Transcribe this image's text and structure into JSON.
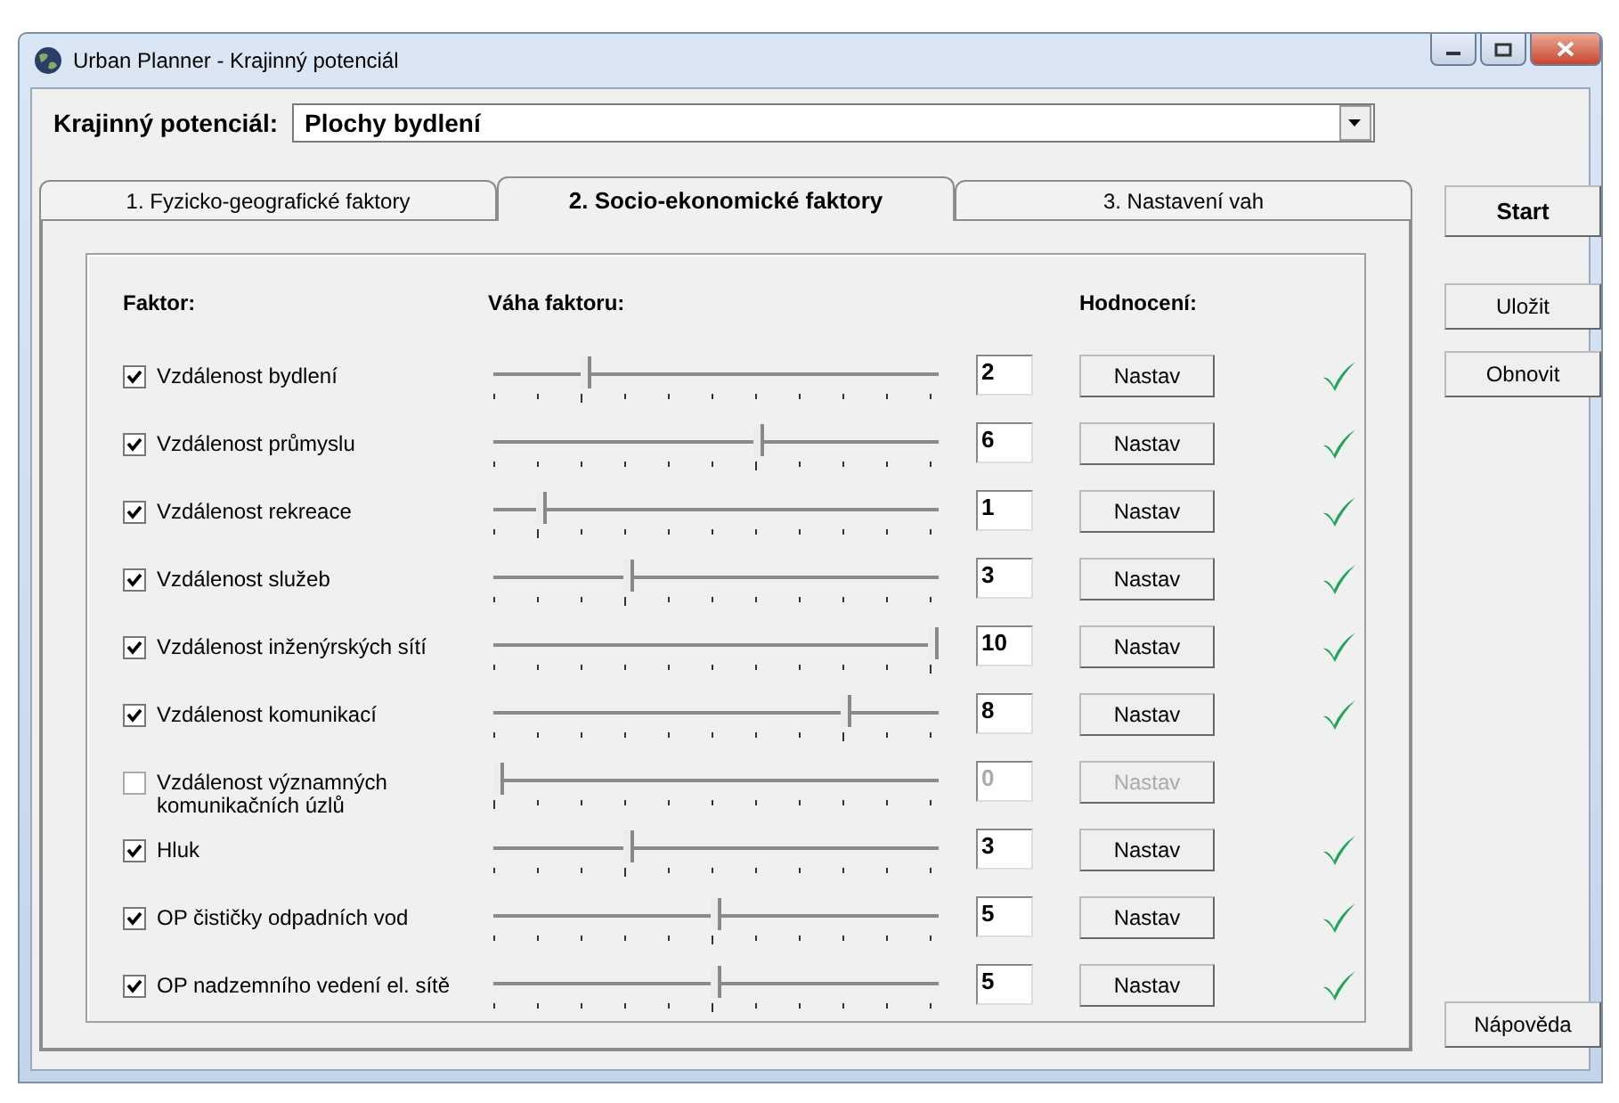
{
  "window": {
    "title": "Urban Planner - Krajinný potenciál"
  },
  "potential": {
    "label": "Krajinný potenciál:",
    "value": "Plochy bydlení"
  },
  "tabs": [
    {
      "label": "1. Fyzicko-geografické faktory",
      "selected": false
    },
    {
      "label": "2. Socio-ekonomické faktory",
      "selected": true
    },
    {
      "label": "3. Nastavení vah",
      "selected": false
    }
  ],
  "headers": {
    "factor": "Faktor:",
    "weight": "Váha faktoru:",
    "rating": "Hodnocení:"
  },
  "rows": [
    {
      "label": "Vzdálenost bydlení",
      "checked": true,
      "level": 0.2,
      "value": "2",
      "button": "Nastav",
      "rated": true
    },
    {
      "label": "Vzdálenost průmyslu",
      "checked": true,
      "level": 0.6,
      "value": "6",
      "button": "Nastav",
      "rated": true
    },
    {
      "label": "Vzdálenost rekreace",
      "checked": true,
      "level": 0.1,
      "value": "1",
      "button": "Nastav",
      "rated": true
    },
    {
      "label": "Vzdálenost služeb",
      "checked": true,
      "level": 0.3,
      "value": "3",
      "button": "Nastav",
      "rated": true
    },
    {
      "label": "Vzdálenost inženýrských sítí",
      "checked": true,
      "level": 1,
      "value": "10",
      "button": "Nastav",
      "rated": true
    },
    {
      "label": "Vzdálenost komunikací",
      "checked": true,
      "level": 0.8,
      "value": "8",
      "button": "Nastav",
      "rated": true
    },
    {
      "label": "Vzdálenost významných komunikačních úzlů",
      "checked": false,
      "level": 0,
      "value": "0",
      "button": "Nastav",
      "rated": false
    },
    {
      "label": "Hluk",
      "checked": true,
      "level": 0.3,
      "value": "3",
      "button": "Nastav",
      "rated": true
    },
    {
      "label": "OP čističky odpadních vod",
      "checked": true,
      "level": 0.5,
      "value": "5",
      "button": "Nastav",
      "rated": true
    },
    {
      "label": "OP nadzemního vedení el. sítě",
      "checked": true,
      "level": 0.5,
      "value": "5",
      "button": "Nastav",
      "rated": true
    }
  ],
  "side_buttons": {
    "start": "Start",
    "save": "Uložit",
    "refresh": "Obnovit",
    "help": "Nápověda"
  }
}
